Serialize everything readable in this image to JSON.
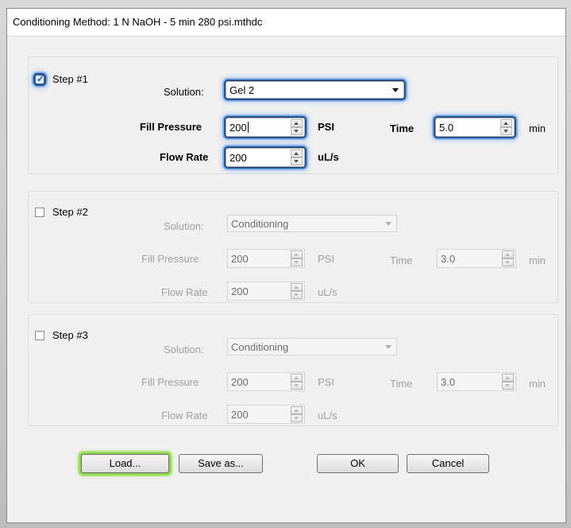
{
  "window": {
    "title": "Conditioning Method: 1 N NaOH - 5 min 280 psi.mthdc"
  },
  "steps": [
    {
      "label": "Step #1",
      "checked": true,
      "solution_label": "Solution:",
      "solution": "Gel 2",
      "fill_pressure_label": "Fill Pressure",
      "fill_pressure": "200",
      "pressure_unit": "PSI",
      "time_label": "Time",
      "time": "5.0",
      "time_unit": "min",
      "flow_rate_label": "Flow Rate",
      "flow_rate": "200",
      "flow_unit": "uL/s"
    },
    {
      "label": "Step #2",
      "checked": false,
      "solution_label": "Solution:",
      "solution": "Conditioning",
      "fill_pressure_label": "Fill Pressure",
      "fill_pressure": "200",
      "pressure_unit": "PSI",
      "time_label": "Time",
      "time": "3.0",
      "time_unit": "min",
      "flow_rate_label": "Flow Rate",
      "flow_rate": "200",
      "flow_unit": "uL/s"
    },
    {
      "label": "Step #3",
      "checked": false,
      "solution_label": "Solution:",
      "solution": "Conditioning",
      "fill_pressure_label": "Fill Pressure",
      "fill_pressure": "200",
      "pressure_unit": "PSI",
      "time_label": "Time",
      "time": "3.0",
      "time_unit": "min",
      "flow_rate_label": "Flow Rate",
      "flow_rate": "200",
      "flow_unit": "uL/s"
    }
  ],
  "buttons": {
    "load": "Load...",
    "save_as": "Save as...",
    "ok": "OK",
    "cancel": "Cancel"
  },
  "colors": {
    "highlight_blue": "#2a4f86",
    "highlight_green": "#8cd24a",
    "dialog_bg": "#f0f0f0"
  }
}
